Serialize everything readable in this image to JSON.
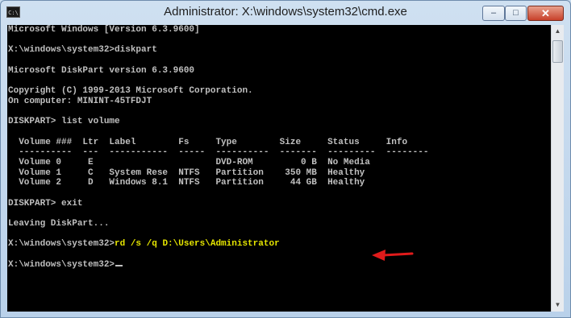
{
  "window": {
    "title": "Administrator: X:\\windows\\system32\\cmd.exe",
    "icon_text": "C:\\",
    "controls": {
      "minimize": "–",
      "maximize": "□",
      "close": "✕"
    }
  },
  "console": {
    "lines": [
      "Microsoft Windows [Version 6.3.9600]",
      "",
      "X:\\windows\\system32>diskpart",
      "",
      "Microsoft DiskPart version 6.3.9600",
      "",
      "Copyright (C) 1999-2013 Microsoft Corporation.",
      "On computer: MININT-45TFDJT",
      "",
      "DISKPART> list volume",
      "",
      "  Volume ###  Ltr  Label        Fs     Type        Size     Status     Info",
      "  ----------  ---  -----------  -----  ----------  -------  ---------  --------",
      "  Volume 0     E                       DVD-ROM         0 B  No Media",
      "  Volume 1     C   System Rese  NTFS   Partition    350 MB  Healthy",
      "  Volume 2     D   Windows 8.1  NTFS   Partition     44 GB  Healthy",
      "",
      "DISKPART> exit",
      "",
      "Leaving DiskPart...",
      "",
      "X:\\windows\\system32>",
      "",
      "X:\\windows\\system32>"
    ],
    "highlight_command": "rd /s /q D:\\Users\\Administrator",
    "highlight_line_index": 21
  },
  "colors": {
    "console_bg": "#000000",
    "console_text": "#c0c0c0",
    "highlight_text": "#e6e600",
    "arrow": "#e01b1b"
  }
}
